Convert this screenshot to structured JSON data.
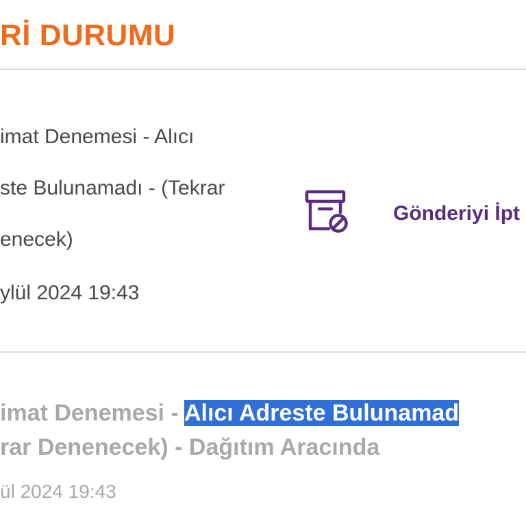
{
  "header": {
    "title": "Rİ DURUMU"
  },
  "current_status": {
    "line1": "imat Denemesi - Alıcı",
    "line2": "ste Bulunamadı - (Tekrar",
    "line3": "enecek)",
    "date": "ylül 2024 19:43"
  },
  "actions": {
    "cancel_label": "Gönderiyi İpt",
    "cancel_icon": "package-cancel-icon"
  },
  "history": {
    "item1": {
      "prefix": "imat Denemesi - ",
      "highlighted": "Alıcı Adreste Bulunamad",
      "line2": "rar Denenecek) - Dağıtım Aracında",
      "date": "ül 2024 19:43"
    }
  },
  "colors": {
    "title": "#f26a1b",
    "accent": "#5a2d82",
    "highlight": "#2f6fd6",
    "muted_text": "#a9a9a9",
    "body_text": "#4a4a4a"
  }
}
